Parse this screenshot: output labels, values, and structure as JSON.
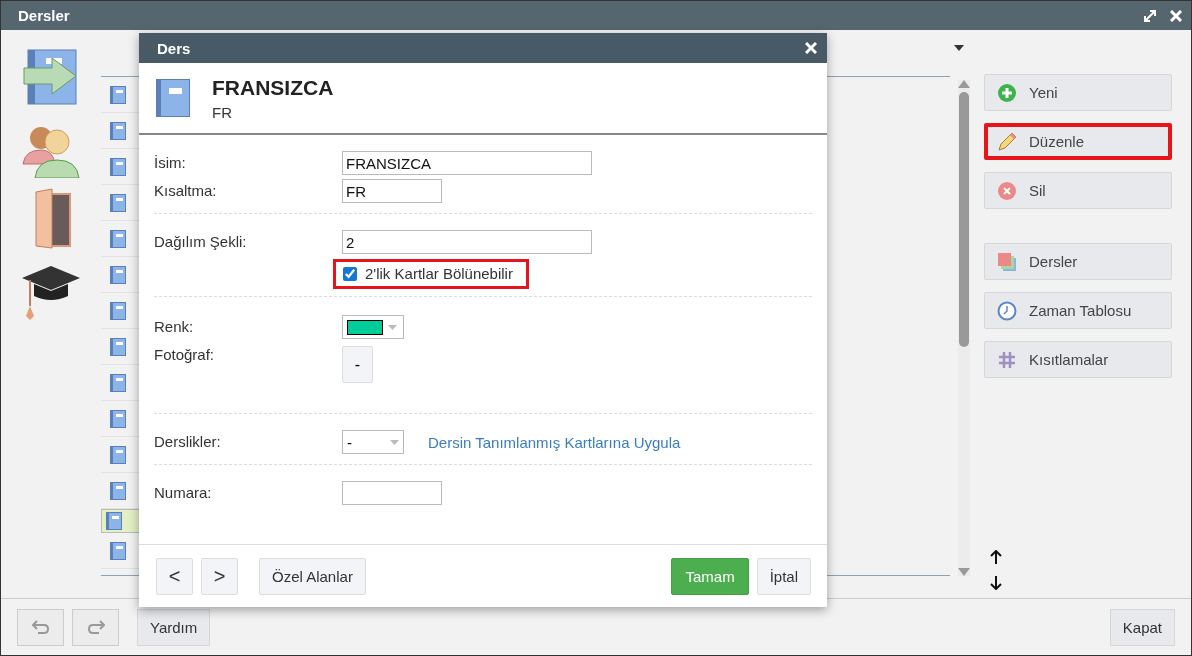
{
  "window": {
    "title": "Dersler"
  },
  "list": {
    "rows": [
      {
        "selected": false
      },
      {
        "selected": false
      },
      {
        "selected": false
      },
      {
        "selected": false
      },
      {
        "selected": false
      },
      {
        "selected": false
      },
      {
        "selected": false
      },
      {
        "selected": false
      },
      {
        "selected": false
      },
      {
        "selected": false
      },
      {
        "selected": false
      },
      {
        "selected": false
      },
      {
        "selected": true
      },
      {
        "selected": false
      }
    ]
  },
  "actions": [
    {
      "label": "Yeni",
      "kind": "new",
      "highlighted": false
    },
    {
      "label": "Düzenle",
      "kind": "edit",
      "highlighted": true
    },
    {
      "label": "Sil",
      "kind": "delete",
      "highlighted": false
    },
    {
      "label": "Dersler",
      "kind": "lessons",
      "highlighted": false
    },
    {
      "label": "Zaman Tablosu",
      "kind": "timetable",
      "highlighted": false
    },
    {
      "label": "Kısıtlamalar",
      "kind": "constraints",
      "highlighted": false
    }
  ],
  "dialog": {
    "title": "Ders",
    "name": "FRANSIZCA",
    "short_name": "FR",
    "sections": [
      [
        {
          "kind": "text",
          "label": "İsim:",
          "value": "FRANSIZCA",
          "wide": true
        },
        {
          "kind": "text",
          "label": "Kısaltma:",
          "value": "FR",
          "wide": false
        }
      ],
      [
        {
          "kind": "text",
          "label": "Dağılım Şekli:",
          "value": "2",
          "wide": true
        },
        {
          "kind": "checkbox",
          "text": "2'lik Kartlar Bölünebilir",
          "checked": true,
          "highlighted": true
        }
      ],
      [
        {
          "kind": "color",
          "label": "Renk:",
          "color": "#00cc99"
        },
        {
          "kind": "button",
          "label": "Fotoğraf:",
          "value": "-"
        }
      ],
      [
        {
          "kind": "select",
          "label": "Derslikler:",
          "value": "-",
          "link": "Dersin Tanımlanmış Kartlarına Uygula"
        }
      ],
      [
        {
          "kind": "text",
          "label": "Numara:",
          "wide": false
        }
      ]
    ],
    "nav_buttons": [
      "<",
      ">"
    ],
    "custom_fields": "Özel Alanlar",
    "ok": "Tamam",
    "cancel": "İptal"
  },
  "bottom": {
    "help": "Yardım",
    "close": "Kapat"
  }
}
